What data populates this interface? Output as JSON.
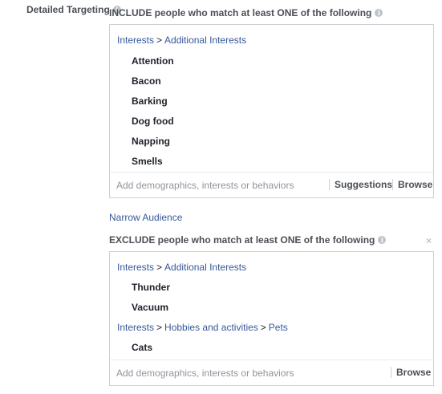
{
  "detailed_targeting_label": "Detailed Targeting",
  "info_glyph": "i",
  "include": {
    "title": "INCLUDE people who match at least ONE of the following",
    "path": [
      "Interests",
      "Additional Interests"
    ],
    "items": [
      "Attention",
      "Bacon",
      "Barking",
      "Dog food",
      "Napping",
      "Smells"
    ],
    "placeholder": "Add demographics, interests or behaviors",
    "suggestions_label": "Suggestions",
    "browse_label": "Browse"
  },
  "narrow_audience_label": "Narrow Audience",
  "exclude": {
    "title": "EXCLUDE people who match at least ONE of the following",
    "close_glyph": "×",
    "group1": {
      "path": [
        "Interests",
        "Additional Interests"
      ],
      "items": [
        "Thunder",
        "Vacuum"
      ]
    },
    "group2": {
      "path": [
        "Interests",
        "Hobbies and activities",
        "Pets"
      ],
      "items": [
        "Cats"
      ]
    },
    "placeholder": "Add demographics, interests or behaviors",
    "browse_label": "Browse"
  },
  "path_separator": ">"
}
